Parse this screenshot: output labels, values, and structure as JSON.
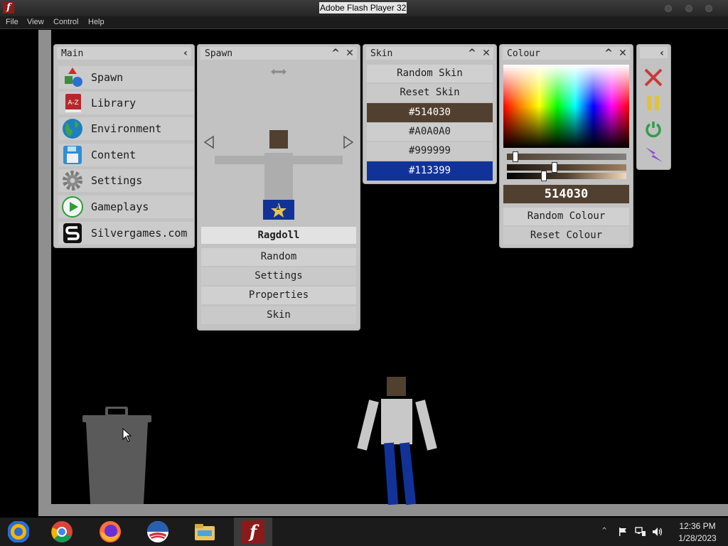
{
  "window": {
    "title": "Adobe Flash Player 32"
  },
  "menubar": {
    "items": [
      "File",
      "View",
      "Control",
      "Help"
    ]
  },
  "main_panel": {
    "title": "Main",
    "items": [
      "Spawn",
      "Library",
      "Environment",
      "Content",
      "Settings",
      "Gameplays",
      "Silvergames.com"
    ],
    "library_icon_text": "A-Z"
  },
  "spawn_panel": {
    "title": "Spawn",
    "selected_object": "Ragdoll",
    "badge_number": "1",
    "buttons": [
      "Random",
      "Settings",
      "Properties",
      "Skin"
    ]
  },
  "skin_panel": {
    "title": "Skin",
    "actions": [
      "Random Skin",
      "Reset Skin"
    ],
    "swatches": [
      "#514030",
      "#A0A0A0",
      "#999999",
      "#113399"
    ],
    "selected_swatch": "#113399"
  },
  "colour_panel": {
    "title": "Colour",
    "hex_value": "514030",
    "current_colour": "#514030",
    "actions": [
      "Random Colour",
      "Reset Colour"
    ],
    "slider_levels": [
      0.07,
      0.4,
      0.31
    ]
  },
  "toolbox": {
    "tools": [
      "delete-all-icon",
      "pause-icon",
      "power-icon",
      "lightning-icon"
    ]
  },
  "colors": {
    "head": "#514030",
    "shirt": "#A0A0A0",
    "arms": "#C8C8C8",
    "pants": "#113399",
    "trash": "#5a5a5a"
  },
  "taskbar": {
    "apps": [
      "chromium-icon",
      "chrome-icon",
      "firefox-icon",
      "obama-logo-icon",
      "file-explorer-icon",
      "flash-player-icon"
    ],
    "time": "12:36 PM",
    "date": "1/28/2023"
  }
}
